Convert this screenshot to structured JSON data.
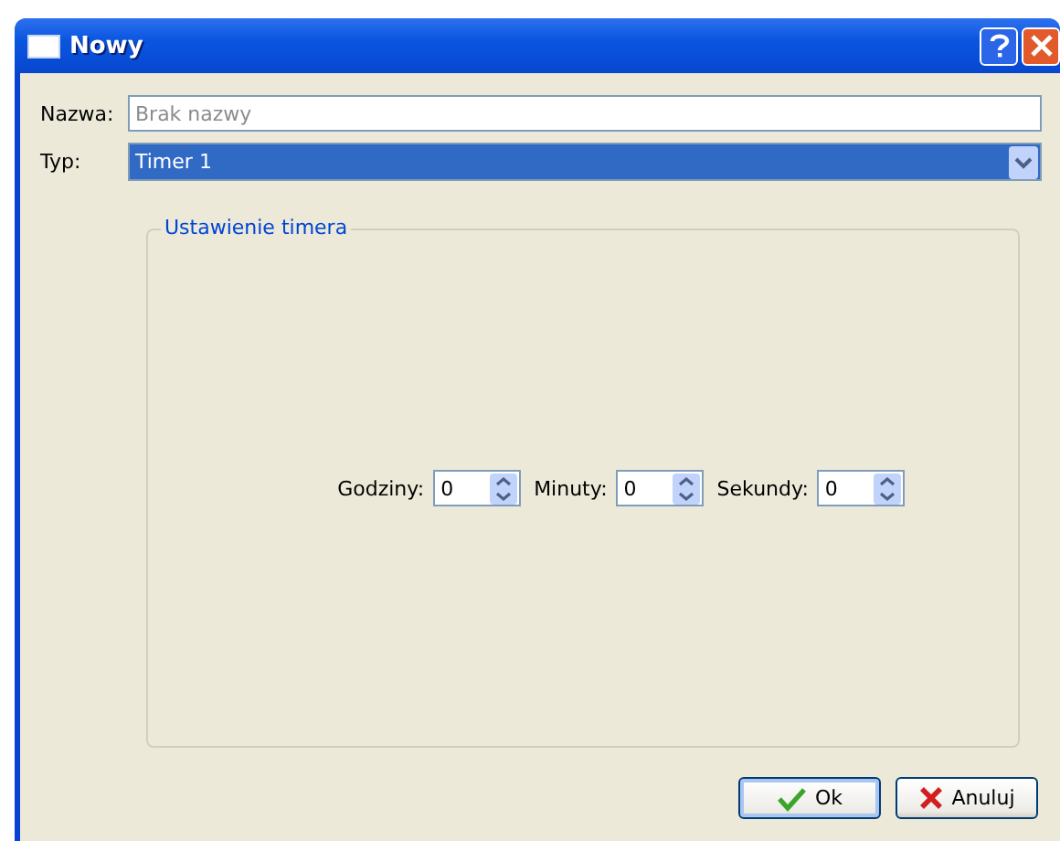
{
  "window": {
    "title": "Nowy"
  },
  "name_field": {
    "label": "Nazwa:",
    "placeholder": "Brak nazwy"
  },
  "type_field": {
    "label": "Typ:",
    "value": "Timer 1"
  },
  "group": {
    "title": "Ustawienie timera"
  },
  "spinners": [
    {
      "label": "Godziny:",
      "value": "0"
    },
    {
      "label": "Minuty:",
      "value": "0"
    },
    {
      "label": "Sekundy:",
      "value": "0"
    }
  ],
  "buttons": [
    {
      "label": "Ok",
      "kind": "ok",
      "default": true
    },
    {
      "label": "Anuluj",
      "kind": "cancel",
      "default": false
    }
  ]
}
